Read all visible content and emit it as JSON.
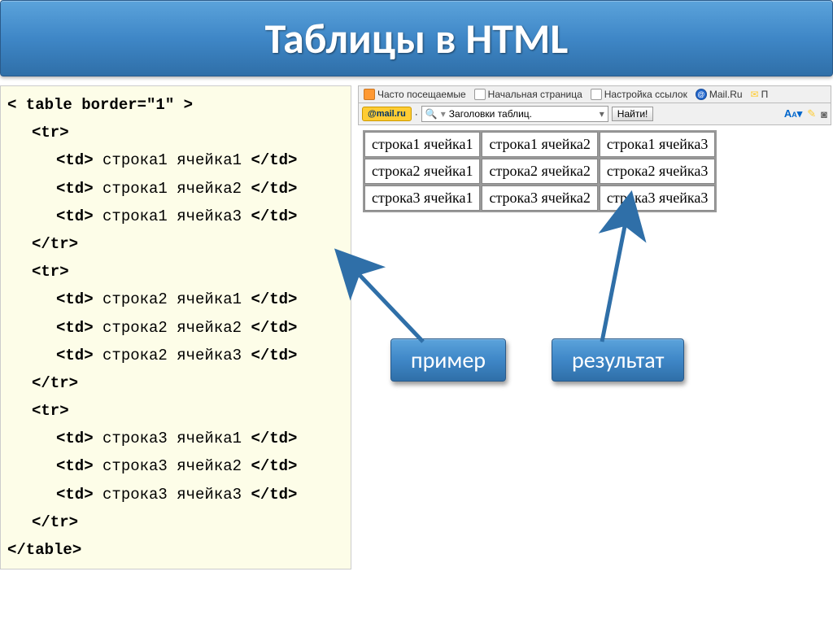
{
  "title": "Таблицы в HTML",
  "code": {
    "open_table": "< table border=\"1\" >",
    "tr_open": "<tr>",
    "tr_close": "</tr>",
    "table_close": "</table>",
    "rows": [
      [
        "<td> строка1 ячейка1 </td>",
        "<td> строка1 ячейка2 </td>",
        "<td> строка1 ячейка3 </td>"
      ],
      [
        "<td> строка2 ячейка1 </td>",
        "<td> строка2 ячейка2 </td>",
        "<td> строка2 ячейка3 </td>"
      ],
      [
        "<td> строка3 ячейка1 </td>",
        "<td> строка3 ячейка2 </td>",
        "<td> строка3 ячейка3 </td>"
      ]
    ]
  },
  "bookmarks": {
    "frequent": "Часто посещаемые",
    "start": "Начальная страница",
    "links": "Настройка ссылок",
    "mail": "Mail.Ru",
    "partial": "П"
  },
  "search": {
    "mail_logo": "@mail.ru",
    "placeholder": "Заголовки таблиц.",
    "find_btn": "Найти!",
    "icon_aa": "A",
    "icon_small_a": "A"
  },
  "table": [
    [
      "строка1 ячейка1",
      "строка1 ячейка2",
      "строка1 ячейка3"
    ],
    [
      "строка2 ячейка1",
      "строка2 ячейка2",
      "строка2 ячейка3"
    ],
    [
      "строка3 ячейка1",
      "строка3 ячейка2",
      "строка3 ячейка3"
    ]
  ],
  "labels": {
    "example": "пример",
    "result": "результат"
  }
}
